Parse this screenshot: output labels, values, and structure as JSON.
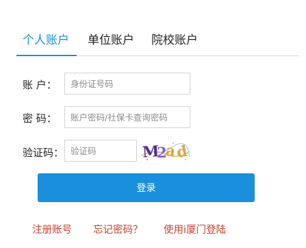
{
  "tabs": [
    {
      "label": "个人账户",
      "active": true
    },
    {
      "label": "单位账户",
      "active": false
    },
    {
      "label": "院校账户",
      "active": false
    }
  ],
  "form": {
    "account_label": "账 户：",
    "account_placeholder": "身份证号码",
    "account_value": "",
    "password_label": "密 码：",
    "password_placeholder": "账户密码/社保卡查询密码",
    "password_value": "",
    "captcha_label": "验证码：",
    "captcha_placeholder": "验证码",
    "captcha_value": "",
    "captcha_image_text": "M2ad"
  },
  "login_button": "登录",
  "links": {
    "register": "注册账号",
    "forgot": "忘记密码？",
    "ixiamen": "使用i厦门登陆"
  },
  "colors": {
    "accent": "#1a8fd4",
    "button": "#1a8fdc",
    "link": "#c8402e"
  }
}
